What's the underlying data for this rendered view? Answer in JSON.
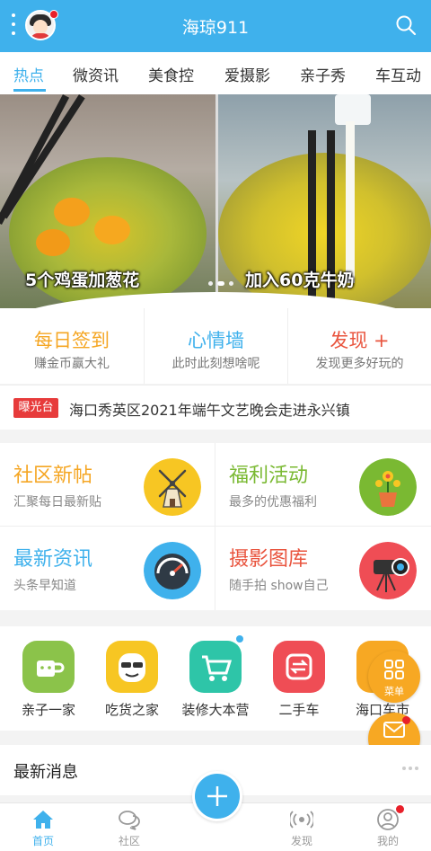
{
  "header": {
    "title": "海琼911"
  },
  "tabs": [
    {
      "label": "热点"
    },
    {
      "label": "微资讯"
    },
    {
      "label": "美食控"
    },
    {
      "label": "爱摄影"
    },
    {
      "label": "亲子秀"
    },
    {
      "label": "车互动"
    }
  ],
  "banner": {
    "left_caption": "5个鸡蛋加葱花",
    "right_caption": "加入60克牛奶"
  },
  "quick_links": [
    {
      "title": "每日签到",
      "sub": "赚金币赢大礼",
      "color": "#f5a623"
    },
    {
      "title": "心情墙",
      "sub": "此时此刻想啥呢",
      "color": "#3fb1ec"
    },
    {
      "title": "发现 +",
      "sub": "发现更多好玩的",
      "color": "#e9543e"
    }
  ],
  "notice": {
    "badge": "曝光台",
    "text": "海口秀英区2021年端午文艺晚会走进永兴镇"
  },
  "features": [
    {
      "title": "社区新帖",
      "sub": "汇聚每日最新贴",
      "color": "#f5a623",
      "icon": "windmill-icon"
    },
    {
      "title": "福利活动",
      "sub": "最多的优惠福利",
      "color": "#7ab932",
      "icon": "flowerpot-icon"
    },
    {
      "title": "最新资讯",
      "sub": "头条早知道",
      "color": "#3fb1ec",
      "icon": "gauge-icon"
    },
    {
      "title": "摄影图库",
      "sub": "随手拍 show自己",
      "color": "#e9543e",
      "icon": "camera-icon"
    }
  ],
  "circles": [
    {
      "label": "亲子一家",
      "color": "#8bc34a",
      "icon": "cup-icon"
    },
    {
      "label": "吃货之家",
      "color": "#f7c623",
      "icon": "foodie-face-icon"
    },
    {
      "label": "装修大本营",
      "color": "#2ec5a8",
      "icon": "cart-icon"
    },
    {
      "label": "二手车",
      "color": "#ef4d55",
      "icon": "swap-icon"
    },
    {
      "label": "海口车市",
      "color": "#f7a823",
      "icon": "car-icon"
    }
  ],
  "fabs": {
    "menu": "菜单",
    "message": "消息"
  },
  "latest": {
    "title": "最新消息"
  },
  "nav": [
    {
      "label": "首页"
    },
    {
      "label": "社区"
    },
    {
      "label": "发现"
    },
    {
      "label": "我的"
    }
  ]
}
